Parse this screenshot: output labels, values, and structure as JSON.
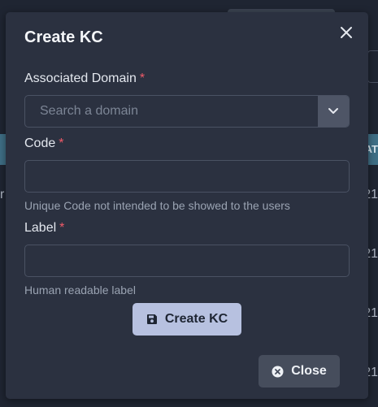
{
  "background": {
    "table_header_partial": "AT",
    "row_fragments": [
      "r",
      "21",
      "21",
      "21",
      "21"
    ]
  },
  "modal": {
    "title": "Create KC",
    "close_icon": "close-icon",
    "fields": {
      "domain": {
        "label": "Associated Domain",
        "required_mark": "*",
        "placeholder": "Search a domain",
        "value": "",
        "dropdown_icon": "chevron-down-icon"
      },
      "code": {
        "label": "Code",
        "required_mark": "*",
        "value": "",
        "help": "Unique Code not intended to be showed to the users"
      },
      "label": {
        "label": "Label",
        "required_mark": "*",
        "value": "",
        "help": "Human readable label"
      }
    },
    "create_button": {
      "label": "Create KC",
      "icon": "save-icon"
    },
    "close_button": {
      "label": "Close",
      "icon": "x-circle-icon"
    }
  },
  "colors": {
    "modal_bg": "#2b3140",
    "page_bg": "#1f2532",
    "primary_button": "#b7c1e0",
    "secondary_button": "#464d5c",
    "required": "#f05a68",
    "table_header": "#3f6f86"
  }
}
